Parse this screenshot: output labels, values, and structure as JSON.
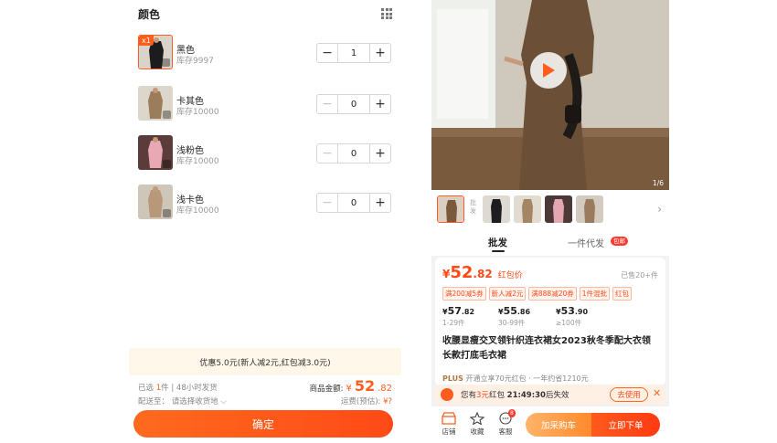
{
  "sku_panel": {
    "title": "颜色",
    "items": [
      {
        "badge": "x1",
        "name": "黑色",
        "stock": "库存9997",
        "qty": "1"
      },
      {
        "name": "卡其色",
        "stock": "库存10000",
        "qty": "0"
      },
      {
        "name": "浅粉色",
        "stock": "库存10000",
        "qty": "0"
      },
      {
        "name": "浅卡色",
        "stock": "库存10000",
        "qty": "0"
      }
    ],
    "stepper": {
      "minus": "−",
      "plus": "+"
    },
    "promo": "优惠5.0元(新人减2元,红包减3.0元)",
    "summary": {
      "selected_prefix": "已选",
      "selected_qty": "1",
      "selected_suffix": "件 | 48小时发货",
      "ship_to": "配送至： 请选择收货地 ⌵",
      "total_label": "商品金额:",
      "total_currency": "¥",
      "total_int": "52",
      "total_dec": ".82",
      "shipping_label": "运费(预估):",
      "shipping_value": "¥?"
    },
    "confirm_label": "确定"
  },
  "product": {
    "image_counter": "1/6",
    "strip_label": "批发",
    "tabs": {
      "active": "批发",
      "other": "一件代发",
      "badge": "包邮"
    },
    "price": {
      "currency": "¥",
      "int": "52",
      "dec": ".82",
      "label": "红包价"
    },
    "sold": "已售20+件",
    "coupons": [
      "满200减5券",
      "新人减2元",
      "满888减20券",
      "1件混批",
      "红包"
    ],
    "tiers": [
      {
        "cur": "¥",
        "int": "57",
        "dec": ".82",
        "range": "1-29件"
      },
      {
        "cur": "¥",
        "int": "55",
        "dec": ".86",
        "range": "30-99件"
      },
      {
        "cur": "¥",
        "int": "53",
        "dec": ".90",
        "range": "≥100件"
      }
    ],
    "title": "收腰显瘦交叉领针织连衣裙女2023秋冬季配大衣领长款打底毛衣裙",
    "plus_row": {
      "brand": "PLUS",
      "text": "开通立享70元红包 · 一年约省1210元"
    },
    "redpack": {
      "prefix": "您有",
      "amount": "3元",
      "mid": "红包",
      "time": "21:49:30",
      "suffix": "后失效",
      "use_label": "去使用",
      "close": "✕"
    },
    "bottom_bar": {
      "store": "店铺",
      "fav": "收藏",
      "service": "客服",
      "service_badge": "8",
      "cart": "加采购车",
      "buy": "立即下单"
    }
  },
  "colors": {
    "accent": "#ff5d1e",
    "accent_dark": "#ff3a12",
    "cart": "#ff9a3c"
  }
}
